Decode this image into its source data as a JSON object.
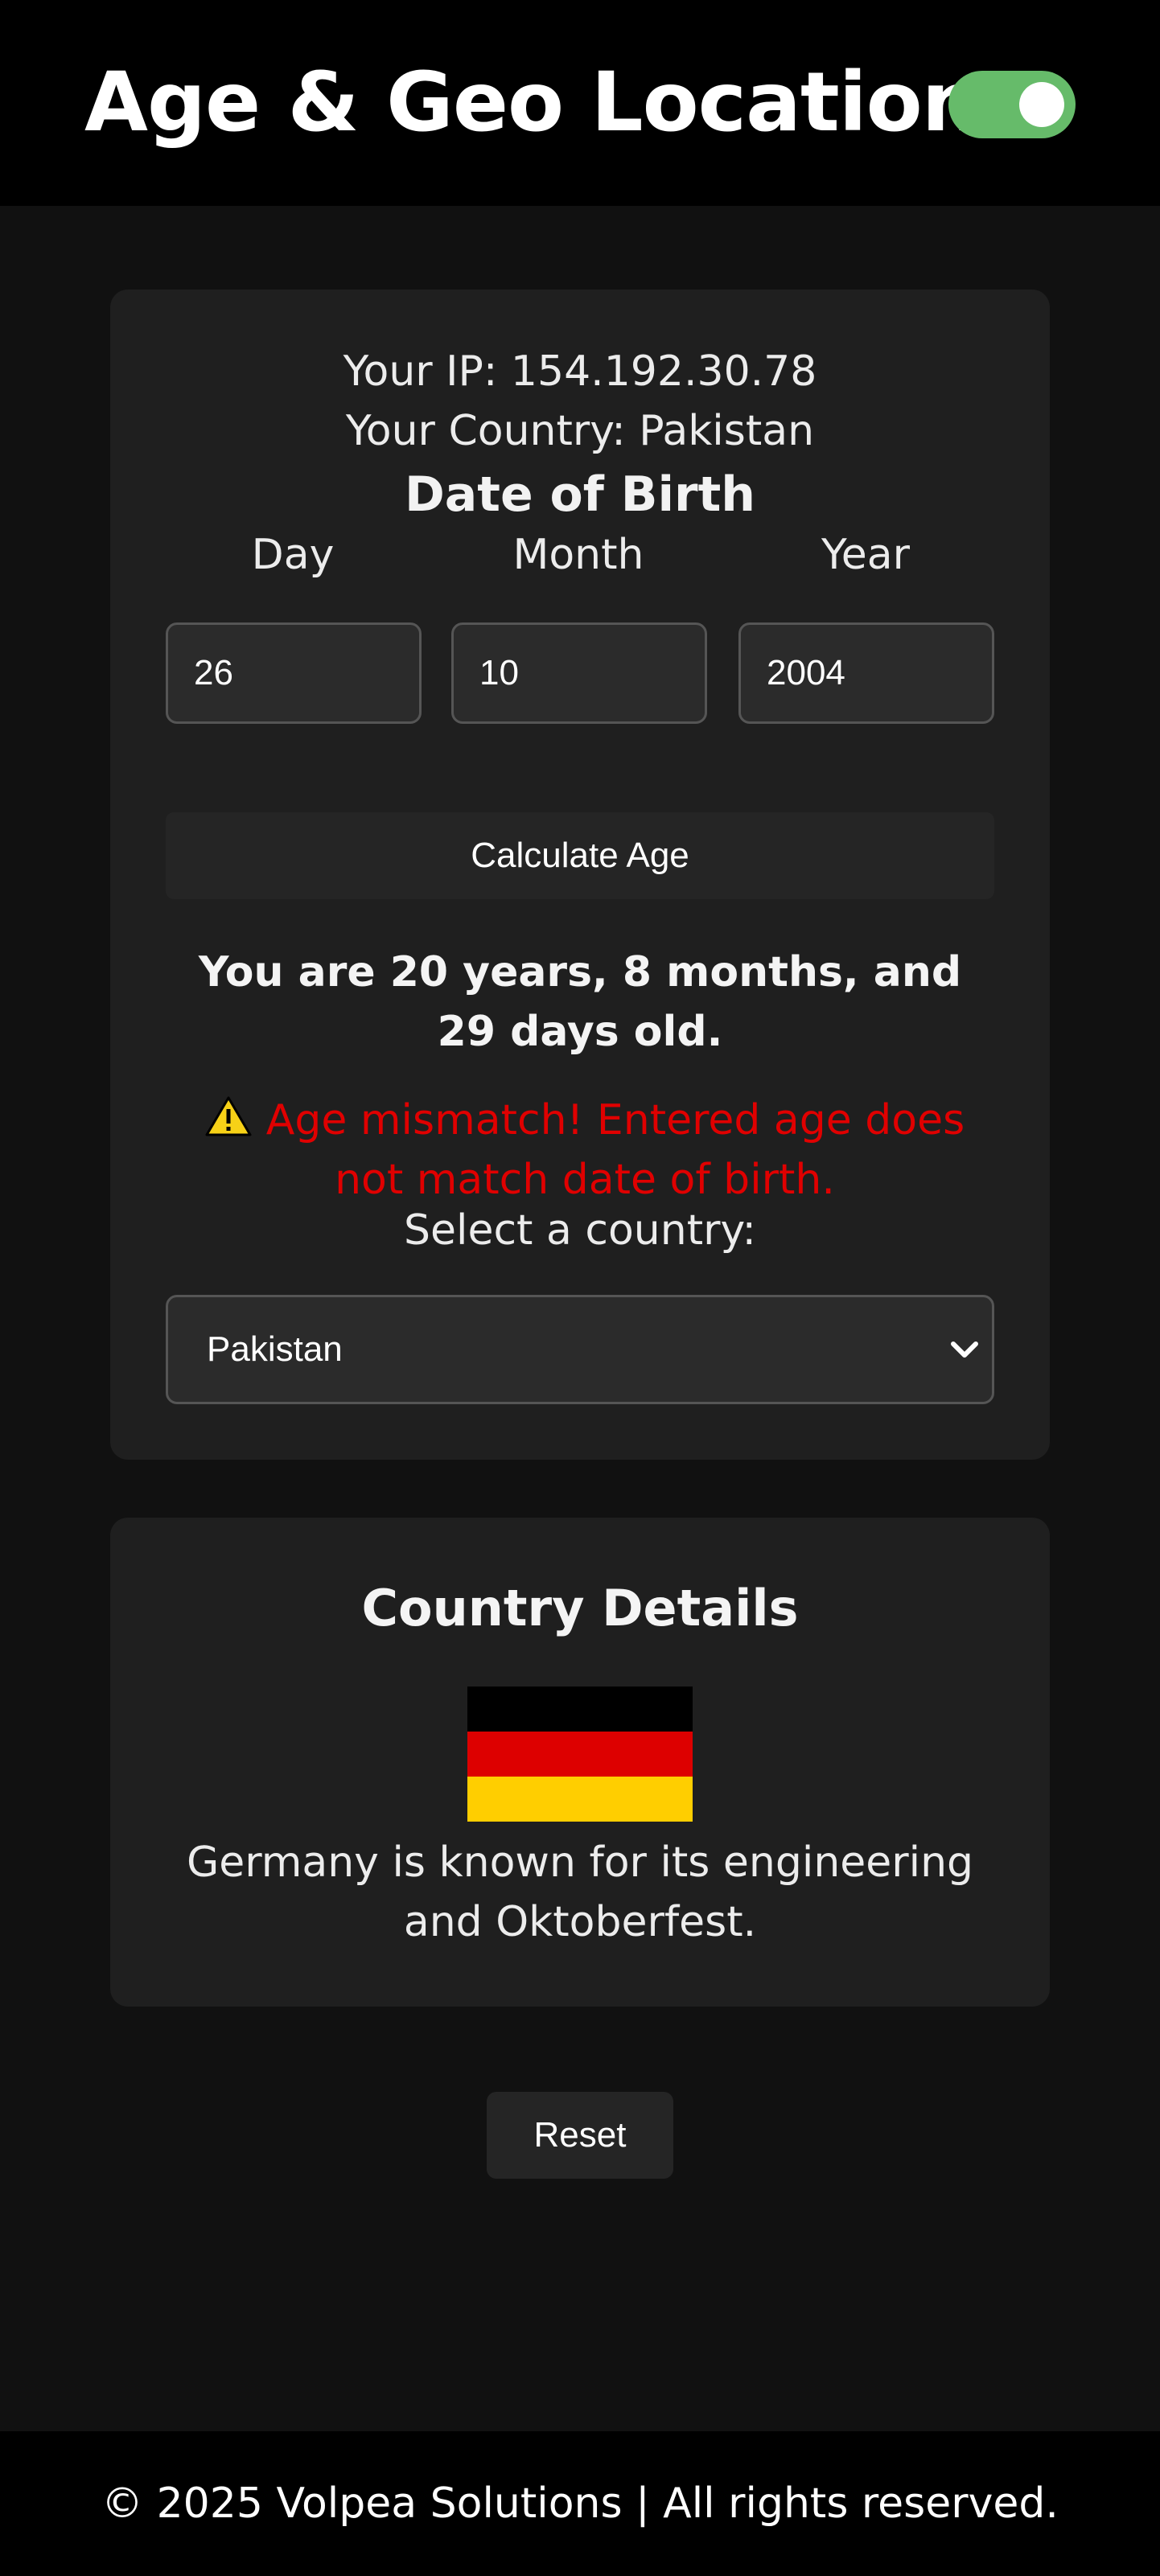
{
  "header": {
    "title": "Age & Geo Location",
    "theme_toggle_on": true,
    "toggle_color": "#66bb6a"
  },
  "geo": {
    "ip_text": "Your IP: 154.192.30.78",
    "country_text": "Your Country: Pakistan"
  },
  "dob": {
    "title": "Date of Birth",
    "day_label": "Day",
    "month_label": "Month",
    "year_label": "Year",
    "day_value": "26",
    "month_value": "10",
    "year_value": "2004"
  },
  "calculate_label": "Calculate Age",
  "result_text": "You are 20 years, 8 months, and 29 days old.",
  "warning": {
    "icon": "warning-icon",
    "text": "Age mismatch! Entered age does not match date of birth.",
    "color": "#e00000"
  },
  "country_select": {
    "label": "Select a country:",
    "selected": "Pakistan",
    "icon": "chevron-down-icon"
  },
  "details": {
    "title": "Country Details",
    "flag_icon": "germany-flag-icon",
    "flag_colors": [
      "#000000",
      "#dd0000",
      "#ffce00"
    ],
    "description": "Germany is known for its engineering and Oktoberfest."
  },
  "reset_label": "Reset",
  "footer": {
    "text": "© 2025 Volpea Solutions | All rights reserved."
  }
}
